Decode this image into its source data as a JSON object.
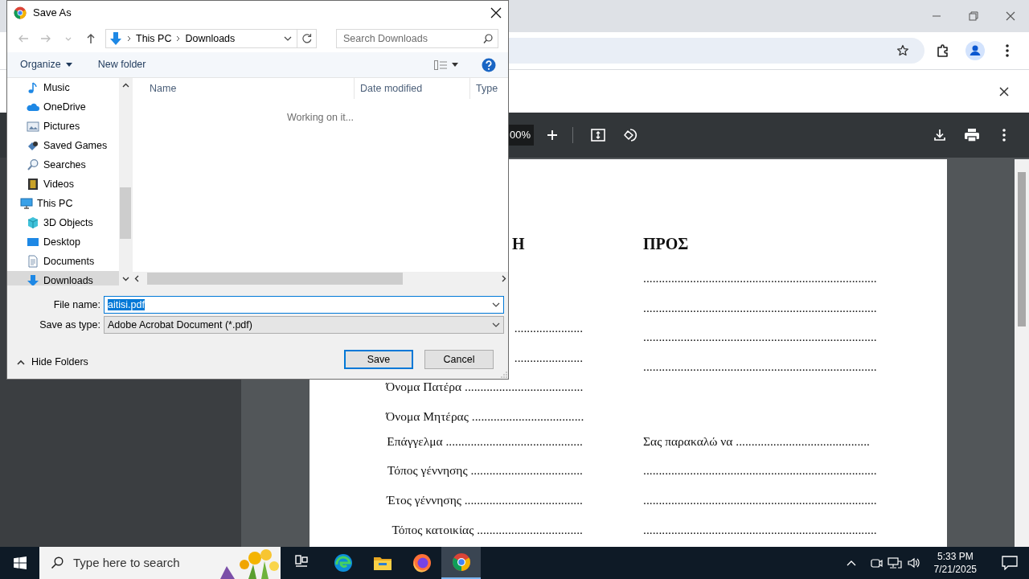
{
  "browser": {
    "pdf_toolbar": {
      "zoom": "00%"
    },
    "pdf_page": {
      "left_heading": "Η",
      "right_heading": "ΠΡΟΣ",
      "left_lines": [
        "......................",
        "......................",
        "Όνομα Πατέρα ......................................",
        "Όνομα Μητέρας  ...................................."
      ],
      "right_lines": [
        "...........................................................................",
        "...........................................................................",
        "...........................................................................",
        "..........................................................................."
      ],
      "rows": [
        {
          "left": "Επάγγελμα  ............................................",
          "right": "Σας παρακαλώ να  ..........................................."
        },
        {
          "left": "Τόπος γέννησης ....................................",
          "right": "..........................................................................."
        },
        {
          "left": "Έτος γέννησης ......................................",
          "right": "..........................................................................."
        },
        {
          "left": "Τόπος κατοικίας  ..................................",
          "right": "..........................................................................."
        }
      ]
    }
  },
  "dialog": {
    "title": "Save As",
    "breadcrumb": [
      "This PC",
      "Downloads"
    ],
    "search": {
      "placeholder": "Search Downloads"
    },
    "commands": [
      {
        "label": "Organize",
        "dropdown": true
      },
      {
        "label": "New folder",
        "dropdown": false
      }
    ],
    "tree": [
      {
        "children": [
          {
            "label": "Music",
            "kind": "music",
            "selected": false
          },
          {
            "label": "OneDrive",
            "kind": "cloud",
            "selected": false
          },
          {
            "label": "Pictures",
            "kind": "pictures",
            "selected": false
          },
          {
            "label": "Saved Games",
            "kind": "games",
            "selected": false
          },
          {
            "label": "Searches",
            "kind": "search",
            "selected": false
          },
          {
            "label": "Videos",
            "kind": "video",
            "selected": false
          }
        ]
      },
      {
        "label": "This PC",
        "kind": "computer",
        "selected": false,
        "children": [
          {
            "label": "3D Objects",
            "kind": "cube",
            "selected": false
          },
          {
            "label": "Desktop",
            "kind": "desktop",
            "selected": false
          },
          {
            "label": "Documents",
            "kind": "document",
            "selected": false
          },
          {
            "label": "Downloads",
            "kind": "download",
            "selected": true
          }
        ]
      }
    ],
    "columns": [
      "Name",
      "Date modified",
      "Type"
    ],
    "status": "Working on it...",
    "file_name": {
      "label": "File name:",
      "value": "aitisi.pdf",
      "text_selected": true
    },
    "save_type": {
      "label": "Save as type:",
      "value": "Adobe Acrobat Document (*.pdf)"
    },
    "hide_folders": "Hide Folders",
    "buttons": [
      {
        "label": "Save",
        "default": true
      },
      {
        "label": "Cancel",
        "default": false
      }
    ]
  },
  "taskbar": {
    "search": {
      "placeholder": "Type here to search"
    },
    "apps": [
      {
        "kind": "taskview",
        "selected": false
      },
      {
        "kind": "edge",
        "selected": false
      },
      {
        "kind": "explorer",
        "selected": false
      },
      {
        "kind": "firefox",
        "selected": false
      },
      {
        "kind": "chrome",
        "selected": true
      }
    ],
    "time": "5:33 PM",
    "date": "7/21/2025"
  }
}
